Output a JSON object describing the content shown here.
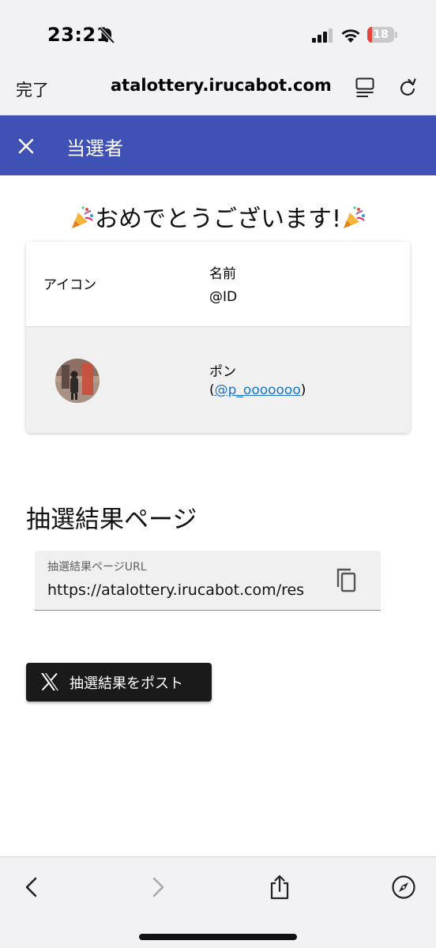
{
  "status_bar": {
    "time": "23:21",
    "battery_level": "18",
    "icons": [
      "bell-slash-icon",
      "signal-icon",
      "wifi-icon",
      "battery-icon"
    ]
  },
  "browser": {
    "done_label": "完了",
    "url": "atalottery.irucabot.com",
    "icons": [
      "reader-icon",
      "reload-icon"
    ]
  },
  "app_bar": {
    "title": "当選者",
    "color": "#3f51b5",
    "icons": [
      "close-icon"
    ]
  },
  "congrats": {
    "text": "おめでとうございます!",
    "icons": [
      "party-popper-icon"
    ]
  },
  "winner_table": {
    "headers": {
      "icon": "アイコン",
      "name": "名前",
      "id": "@ID"
    },
    "rows": [
      {
        "name": "ポン",
        "id_open": "(",
        "id_link": "@p_ooooooo",
        "id_close": ")"
      }
    ]
  },
  "results_section": {
    "title": "抽選結果ページ",
    "url_field_label": "抽選結果ページURL",
    "url_value": "https://atalottery.irucabot.com/res",
    "icons": [
      "copy-icon"
    ]
  },
  "post_button": {
    "label": "抽選結果をポスト",
    "icons": [
      "x-logo-icon"
    ]
  },
  "toolbar": {
    "icons": [
      "back-icon",
      "forward-icon",
      "share-icon",
      "compass-icon"
    ]
  },
  "colors": {
    "link": "#1a73c9",
    "battery_low": "#e5463a",
    "post_button": "#1a1a1a"
  }
}
